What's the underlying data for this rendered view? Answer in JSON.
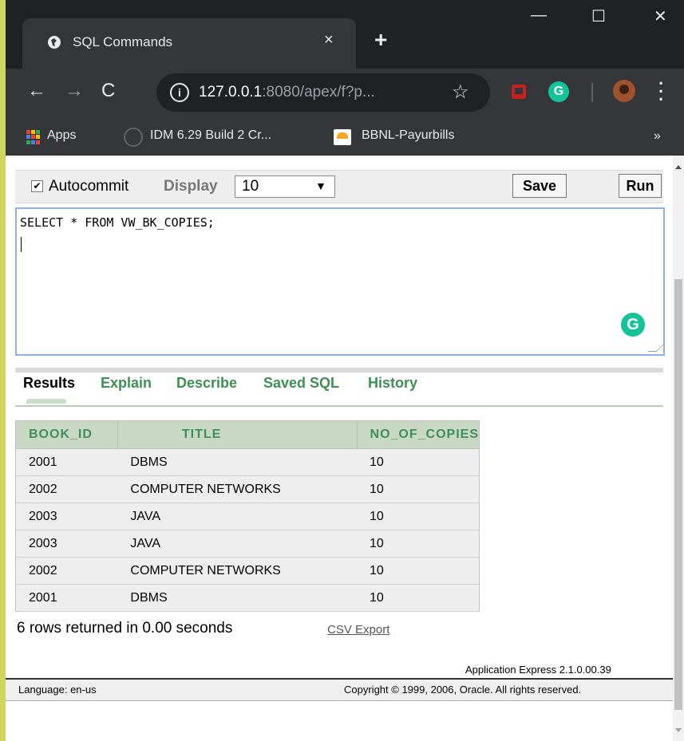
{
  "browser": {
    "tab_title": "SQL Commands",
    "tab_close": "×",
    "new_tab": "+",
    "window_minimize": "—",
    "window_maximize": "☐",
    "window_close": "✕",
    "url_host": "127.0.0.1",
    "url_path": ":8080/apex/f?p...",
    "bookmarks": {
      "apps": "Apps",
      "idm": "IDM 6.29 Build 2 Cr...",
      "bbnl": "BBNL-Payurbills",
      "more": "»"
    }
  },
  "toolbar": {
    "autocommit_label": "Autocommit",
    "autocommit_checked": true,
    "display_label": "Display",
    "display_value": "10",
    "save_label": "Save",
    "run_label": "Run"
  },
  "editor": {
    "sql_text": "SELECT * FROM VW_BK_COPIES;"
  },
  "result_tabs": [
    "Results",
    "Explain",
    "Describe",
    "Saved SQL",
    "History"
  ],
  "results": {
    "columns": [
      "BOOK_ID",
      "TITLE",
      "NO_OF_COPIES"
    ],
    "rows": [
      [
        "2001",
        "DBMS",
        "10"
      ],
      [
        "2002",
        "COMPUTER NETWORKS",
        "10"
      ],
      [
        "2003",
        "JAVA",
        "10"
      ],
      [
        "2003",
        "JAVA",
        "10"
      ],
      [
        "2002",
        "COMPUTER NETWORKS",
        "10"
      ],
      [
        "2001",
        "DBMS",
        "10"
      ]
    ],
    "rows_info": "6 rows returned in 0.00 seconds",
    "csv_export": "CSV Export"
  },
  "footer": {
    "version": "Application Express 2.1.0.00.39",
    "language": "Language: en-us",
    "copyright": "Copyright © 1999, 2006, Oracle. All rights reserved."
  }
}
